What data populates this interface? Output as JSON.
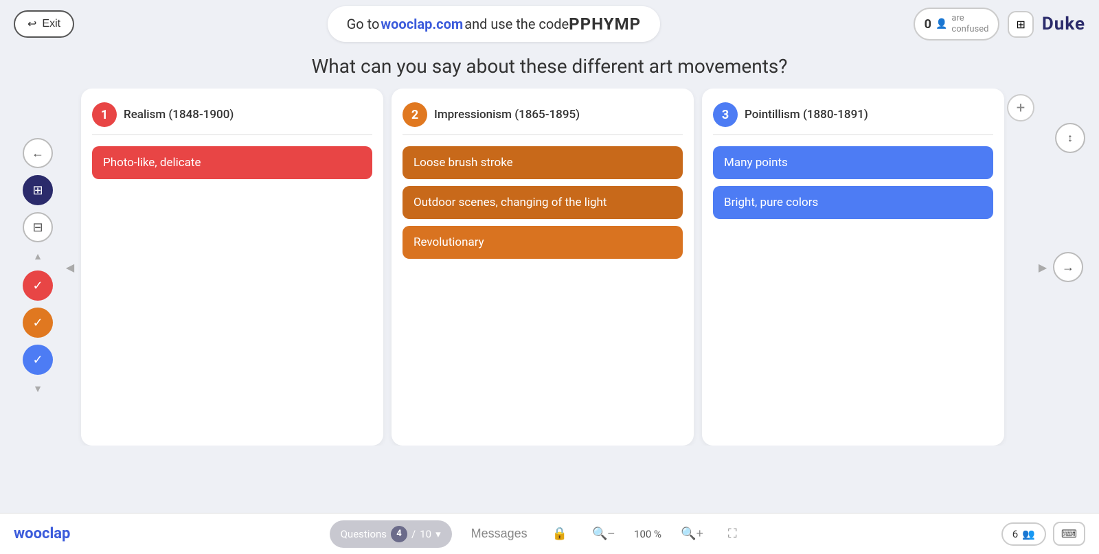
{
  "header": {
    "exit_label": "Exit",
    "code_prefix": "Go to ",
    "site": "wooclap.com",
    "code_middle": " and use the code ",
    "code": "PPHYMP",
    "participants_count": "0",
    "confused_label": "are\nconfused",
    "duke_label": "Duke"
  },
  "question": {
    "text": "What can you say about these different art movements?"
  },
  "columns": [
    {
      "number": "1",
      "badge_class": "badge-red",
      "title": "Realism (1848-1900)",
      "items": [
        {
          "text": "Photo-like, delicate",
          "color_class": "item-red"
        }
      ]
    },
    {
      "number": "2",
      "badge_class": "badge-orange",
      "title": "Impressionism (1865-1895)",
      "items": [
        {
          "text": "Loose brush stroke",
          "color_class": "item-orange"
        },
        {
          "text": "Outdoor scenes, changing of the light",
          "color_class": "item-orange"
        },
        {
          "text": "Revolutionary",
          "color_class": "item-orange-light"
        }
      ]
    },
    {
      "number": "3",
      "badge_class": "badge-blue",
      "title": "Pointillism (1880-1891)",
      "items": [
        {
          "text": "Many points",
          "color_class": "item-blue"
        },
        {
          "text": "Bright, pure colors",
          "color_class": "item-blue"
        }
      ]
    }
  ],
  "footer": {
    "logo": "wooclap",
    "questions_label": "Questions",
    "current_q": "4",
    "total_q": "10",
    "messages_label": "Messages",
    "zoom_level": "100 %",
    "participants_count": "6",
    "keyboard_icon": "⌨"
  },
  "nav": {
    "back_arrow": "←",
    "forward_arrow": "→",
    "up_down_arrow": "↕",
    "left_collapse": "◀",
    "right_expand": "▶",
    "add_column": "+"
  },
  "sidebar_tools": {
    "up_arrow": "▲",
    "check_label": "✓",
    "down_arrow": "▼"
  }
}
